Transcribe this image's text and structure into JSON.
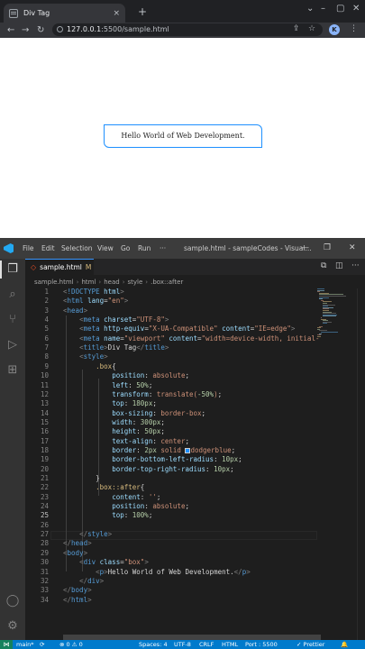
{
  "browser": {
    "tab_title": "Div Tag",
    "tab_close": "×",
    "new_tab": "+",
    "address_host": "127.0.0.1",
    "address_rest": ":5500/sample.html",
    "avatar_letter": "K",
    "page": {
      "box_text": "Hello World of Web Development."
    }
  },
  "vscode": {
    "menu": [
      "File",
      "Edit",
      "Selection",
      "View",
      "Go",
      "Run",
      "···"
    ],
    "window_title": "sample.html - sampleCodes - Visual...",
    "tab": {
      "filename": "sample.html",
      "modified": "M"
    },
    "breadcrumbs": [
      "sample.html",
      "html",
      "head",
      "style",
      ".box::after"
    ],
    "code_lines": [
      {
        "n": "1",
        "html": "<span class='br'>&lt;</span><span class='tag'>!DOCTYPE</span> <span class='attr'>html</span><span class='br'>&gt;</span>"
      },
      {
        "n": "2",
        "html": "<span class='br'>&lt;</span><span class='tag'>html</span> <span class='attr'>lang</span>=<span class='str'>\"en\"</span><span class='br'>&gt;</span>"
      },
      {
        "n": "3",
        "html": "<span class='br'>&lt;</span><span class='tag'>head</span><span class='br'>&gt;</span>"
      },
      {
        "n": "4",
        "html": "    <span class='br'>&lt;</span><span class='tag'>meta</span> <span class='attr'>charset</span>=<span class='str'>\"UTF-8\"</span><span class='br'>&gt;</span>"
      },
      {
        "n": "5",
        "html": "    <span class='br'>&lt;</span><span class='tag'>meta</span> <span class='attr'>http-equiv</span>=<span class='str'>\"X-UA-Compatible\"</span> <span class='attr'>content</span>=<span class='str'>\"IE=edge\"</span><span class='br'>&gt;</span>"
      },
      {
        "n": "6",
        "html": "    <span class='br'>&lt;</span><span class='tag'>meta</span> <span class='attr'>name</span>=<span class='str'>\"viewport\"</span> <span class='attr'>content</span>=<span class='str'>\"width=device-width, initial-</span>"
      },
      {
        "n": "7",
        "html": "    <span class='br'>&lt;</span><span class='tag'>title</span><span class='br'>&gt;</span>Div Tag<span class='br'>&lt;/</span><span class='tag'>title</span><span class='br'>&gt;</span>"
      },
      {
        "n": "8",
        "html": "    <span class='br'>&lt;</span><span class='tag'>style</span><span class='br'>&gt;</span>"
      },
      {
        "n": "9",
        "html": "        <span class='sel'>.box</span>{"
      },
      {
        "n": "10",
        "html": "            <span class='prop'>position</span>: <span class='val'>absolute</span>;"
      },
      {
        "n": "11",
        "html": "            <span class='prop'>left</span>: <span class='num'>50%</span>;"
      },
      {
        "n": "12",
        "html": "            <span class='prop'>transform</span>: <span class='val'>translate(</span><span class='num'>-50%</span><span class='val'>)</span>;"
      },
      {
        "n": "13",
        "html": "            <span class='prop'>top</span>: <span class='num'>180px</span>;"
      },
      {
        "n": "14",
        "html": "            <span class='prop'>box-sizing</span>: <span class='val'>border-box</span>;"
      },
      {
        "n": "15",
        "html": "            <span class='prop'>width</span>: <span class='num'>300px</span>;"
      },
      {
        "n": "16",
        "html": "            <span class='prop'>height</span>: <span class='num'>50px</span>;"
      },
      {
        "n": "17",
        "html": "            <span class='prop'>text-align</span>: <span class='val'>center</span>;"
      },
      {
        "n": "18",
        "html": "            <span class='prop'>border</span>: <span class='num'>2px</span> <span class='val'>solid</span> <span class='swatch'></span><span class='val'>dodgerblue</span>;"
      },
      {
        "n": "19",
        "html": "            <span class='prop'>border-bottom-left-radius</span>: <span class='num'>10px</span>;"
      },
      {
        "n": "20",
        "html": "            <span class='prop'>border-top-right-radius</span>: <span class='num'>10px</span>;"
      },
      {
        "n": "21",
        "html": "        }"
      },
      {
        "n": "22",
        "html": "        <span class='sel'>.box::after</span>{"
      },
      {
        "n": "23",
        "html": "            <span class='prop'>content</span>: <span class='str'>''</span>;"
      },
      {
        "n": "24",
        "html": "            <span class='prop'>position</span>: <span class='val'>absolute</span>;"
      },
      {
        "n": "25",
        "html": "            <span class='prop'>top</span>: <span class='num'>100%</span>;"
      },
      {
        "n": "26",
        "html": ""
      },
      {
        "n": "27",
        "html": "    <span class='br'>&lt;/</span><span class='tag'>style</span><span class='br'>&gt;</span>"
      },
      {
        "n": "28",
        "html": "<span class='br'>&lt;/</span><span class='tag'>head</span><span class='br'>&gt;</span>"
      },
      {
        "n": "29",
        "html": "<span class='br'>&lt;</span><span class='tag'>body</span><span class='br'>&gt;</span>"
      },
      {
        "n": "30",
        "html": "    <span class='br'>&lt;</span><span class='tag'>div</span> <span class='attr'>class</span>=<span class='str'>\"box\"</span><span class='br'>&gt;</span>"
      },
      {
        "n": "31",
        "html": "        <span class='br'>&lt;</span><span class='tag'>p</span><span class='br'>&gt;</span>Hello World of Web Development.<span class='br'>&lt;/</span><span class='tag'>p</span><span class='br'>&gt;</span>"
      },
      {
        "n": "32",
        "html": "    <span class='br'>&lt;/</span><span class='tag'>div</span><span class='br'>&gt;</span>"
      },
      {
        "n": "33",
        "html": "<span class='br'>&lt;/</span><span class='tag'>body</span><span class='br'>&gt;</span>"
      },
      {
        "n": "34",
        "html": "<span class='br'>&lt;/</span><span class='tag'>html</span><span class='br'>&gt;</span>"
      }
    ],
    "current_line": "25",
    "status": {
      "branch": "main*",
      "sync": "⟳",
      "errors": "⊗ 0 ⚠ 0",
      "spaces": "Spaces: 4",
      "encoding": "UTF-8",
      "eol": "CRLF",
      "language": "HTML",
      "port": "Port : 5500",
      "prettier": "✓ Prettier"
    },
    "colors": {
      "accent": "#007acc",
      "remote": "#16825d",
      "swatch": "#1e90ff"
    }
  }
}
